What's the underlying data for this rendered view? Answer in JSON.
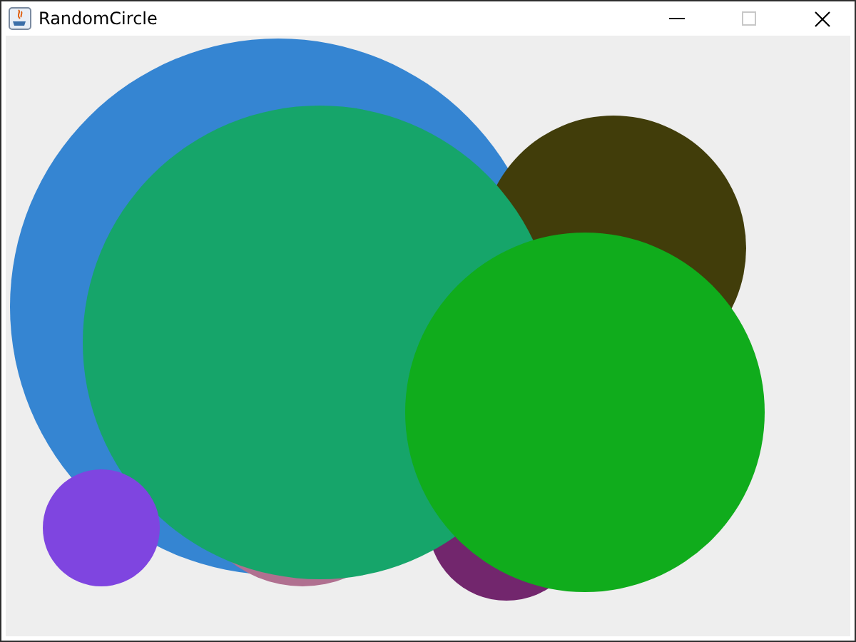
{
  "window": {
    "title": "RandomCircle"
  },
  "controls": [
    {
      "kind": "minimize",
      "disabled": false
    },
    {
      "kind": "maximize",
      "disabled": true
    },
    {
      "kind": "close",
      "disabled": false
    }
  ],
  "circles": [
    {
      "color": "#3585d2"
    },
    {
      "color": "#b07090"
    },
    {
      "color": "#413d0a"
    },
    {
      "color": "#72266d"
    },
    {
      "color": "#16a56a"
    },
    {
      "color": "#10ac1c"
    },
    {
      "color": "#7f45e0"
    }
  ]
}
